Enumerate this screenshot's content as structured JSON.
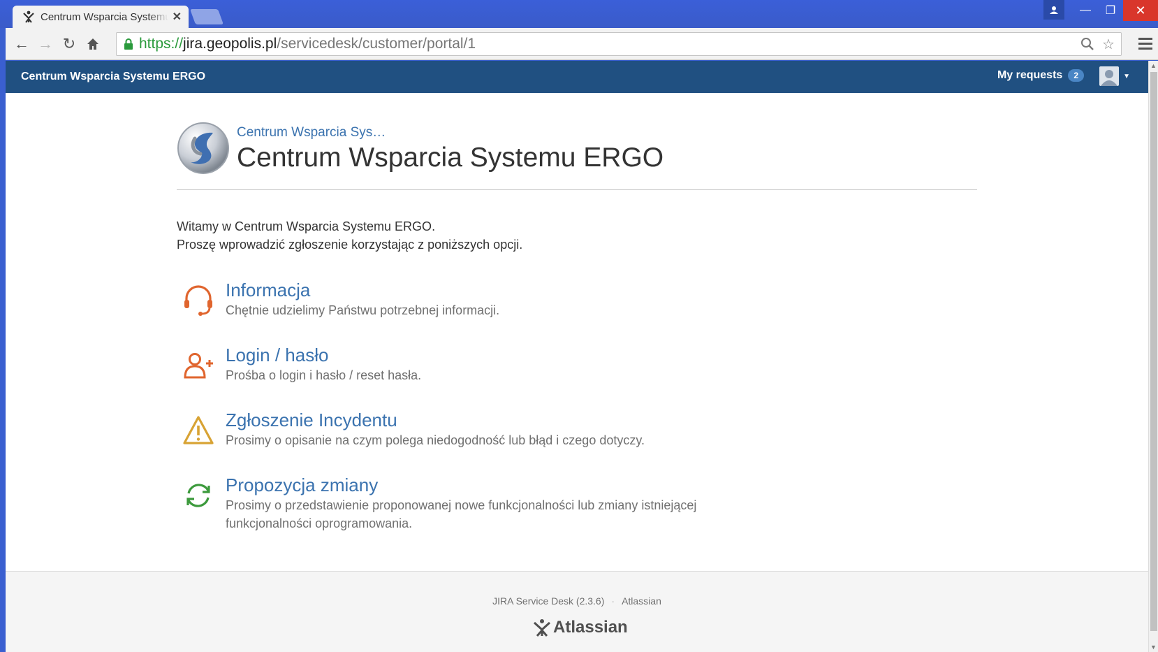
{
  "browser": {
    "tab_title": "Centrum Wsparcia Systemu ERGO",
    "url_scheme": "https://",
    "url_host": "jira.geopolis.pl",
    "url_path": "/servicedesk/customer/portal/1"
  },
  "header": {
    "brand": "Centrum Wsparcia Systemu ERGO",
    "my_requests_label": "My requests",
    "my_requests_count": "2"
  },
  "portal": {
    "breadcrumb": "Centrum Wsparcia Sys…",
    "title": "Centrum Wsparcia Systemu ERGO",
    "welcome_line1": "Witamy w Centrum Wsparcia Systemu ERGO.",
    "welcome_line2": "Proszę wprowadzić zgłoszenie korzystając z poniższych opcji."
  },
  "request_types": [
    {
      "title": "Informacja",
      "description": "Chętnie udzielimy Państwu potrzebnej informacji.",
      "icon": "headset-icon",
      "color": "#e0652e"
    },
    {
      "title": "Login / hasło",
      "description": "Prośba o login i hasło / reset hasła.",
      "icon": "add-user-icon",
      "color": "#e0652e"
    },
    {
      "title": "Zgłoszenie Incydentu",
      "description": "Prosimy o opisanie na czym polega niedogodność lub błąd i czego dotyczy.",
      "icon": "warning-icon",
      "color": "#d8a334"
    },
    {
      "title": "Propozycja zmiany",
      "description": "Prosimy o przedstawienie proponowanej nowe funkcjonalności lub zmiany istniejącej funkcjonalności oprogramowania.",
      "icon": "refresh-icon",
      "color": "#3c9a3c"
    }
  ],
  "footer": {
    "product": "JIRA Service Desk (2.3.6)",
    "separator": "·",
    "vendor": "Atlassian",
    "logo_text": "Atlassian"
  },
  "colors": {
    "header_bg": "#205081",
    "link": "#3b73af",
    "window_frame": "#3a5fd0"
  }
}
